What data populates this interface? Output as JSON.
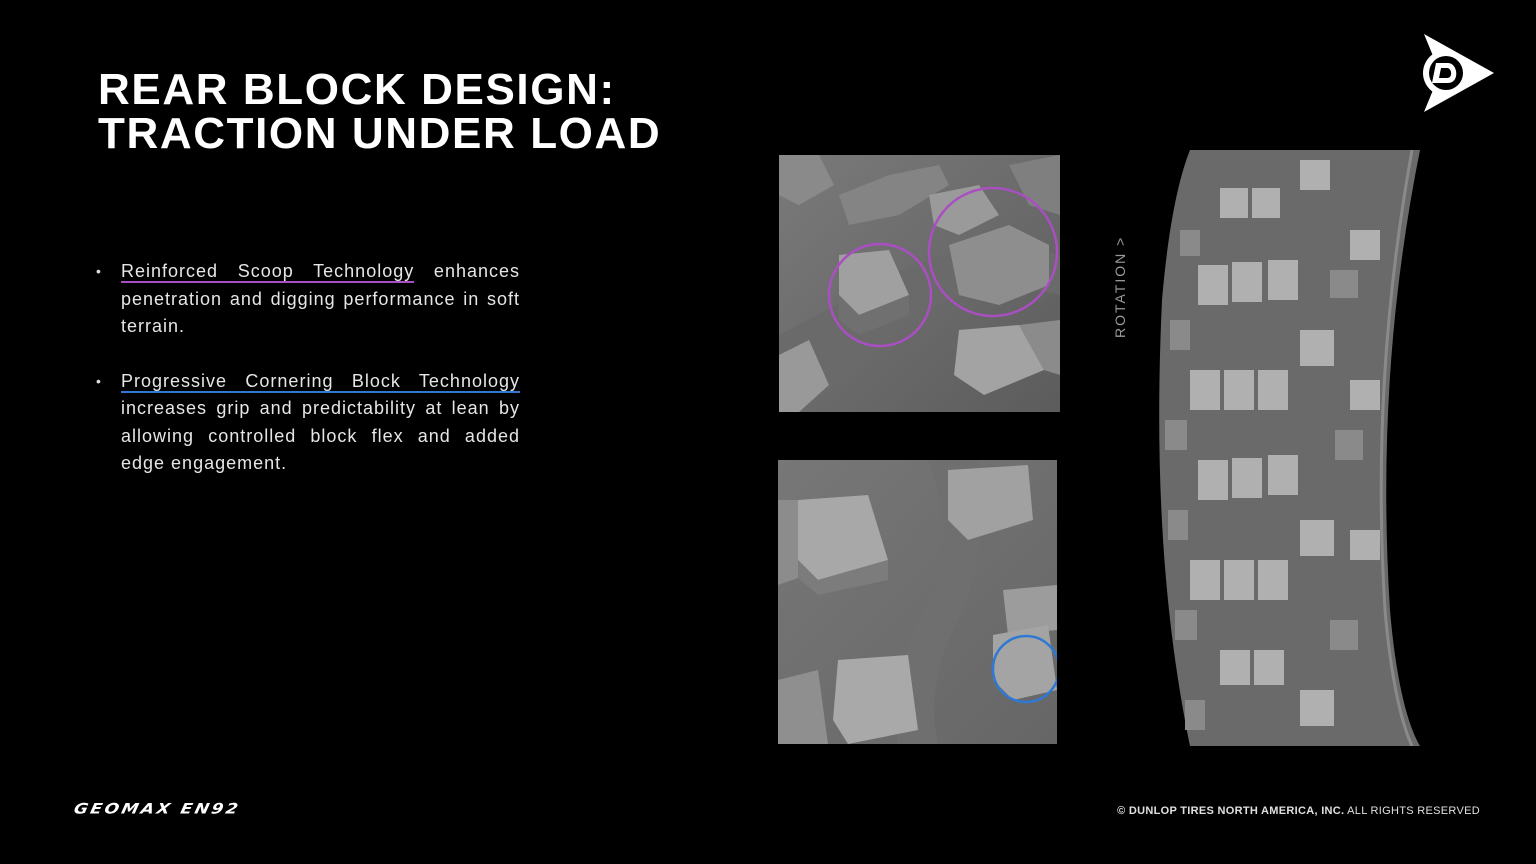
{
  "title": {
    "line1": "REAR BLOCK DESIGN:",
    "line2": "TRACTION UNDER LOAD"
  },
  "bullets": [
    {
      "highlight": "Reinforced Scoop Technology",
      "text": " enhances penetration and digging performance in soft terrain.",
      "highlight_color": "#a94fc2"
    },
    {
      "highlight": "Progressive Cornering Block Technology",
      "text": " increases grip and predictability at lean by allowing controlled block flex and added edge engagement.",
      "highlight_color": "#2f79d4"
    }
  ],
  "rotation_label": "ROTATION >",
  "logo_icon": "dunlop-flying-d-icon",
  "brand_name": "GEOMAX EN92",
  "copyright": {
    "bold": "© DUNLOP TIRES NORTH AMERICA, INC.",
    "rest": " ALL RIGHTS RESERVED"
  },
  "colors": {
    "background": "#000000",
    "accent_purple": "#a94fc2",
    "accent_blue": "#2f79d4"
  }
}
